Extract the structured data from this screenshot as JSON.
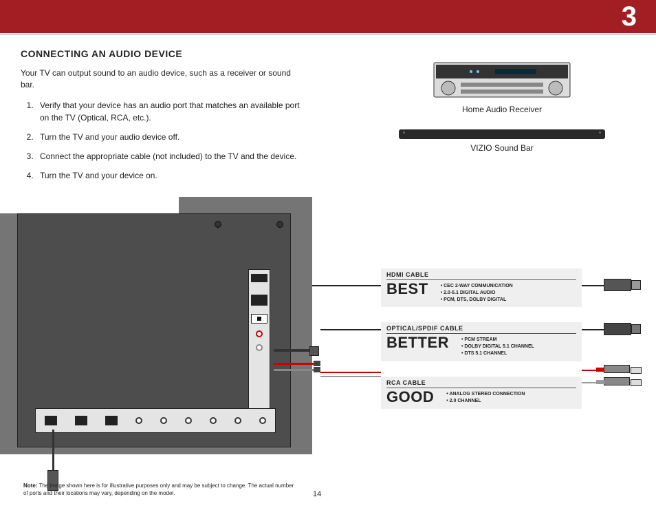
{
  "chapter": "3",
  "title": "CONNECTING AN AUDIO DEVICE",
  "intro": "Your TV can output sound to an audio device, such as a receiver or sound bar.",
  "steps": [
    "Verify that your device has an audio port that matches an available port on the TV (Optical, RCA, etc.).",
    "Turn the TV and your audio device off.",
    "Connect the appropriate cable (not included) to the TV and the device.",
    "Turn the TV and your device on."
  ],
  "devices": {
    "receiver_label": "Home Audio Receiver",
    "soundbar_label": "VIZIO Sound Bar"
  },
  "cables": {
    "hdmi": {
      "header": "HDMI CABLE",
      "rank": "BEST",
      "features": [
        "CEC 2-WAY COMMUNICATION",
        "2.0-5.1 DIGITAL AUDIO",
        "PCM, DTS, DOLBY DIGITAL"
      ]
    },
    "optical": {
      "header": "OPTICAL/SPDIF CABLE",
      "rank": "BETTER",
      "features": [
        "PCM STREAM",
        "DOLBY DIGITAL 5.1 CHANNEL",
        "DTS 5.1 CHANNEL"
      ]
    },
    "rca": {
      "header": "RCA CABLE",
      "rank": "GOOD",
      "features": [
        "ANALOG STEREO CONNECTION",
        "2.0 CHANNEL"
      ]
    }
  },
  "note_label": "Note:",
  "note_text": "The image shown here is for illustrative purposes only and may be subject to change. The actual number of ports and their locations may vary, depending on the model.",
  "page_number": "14"
}
